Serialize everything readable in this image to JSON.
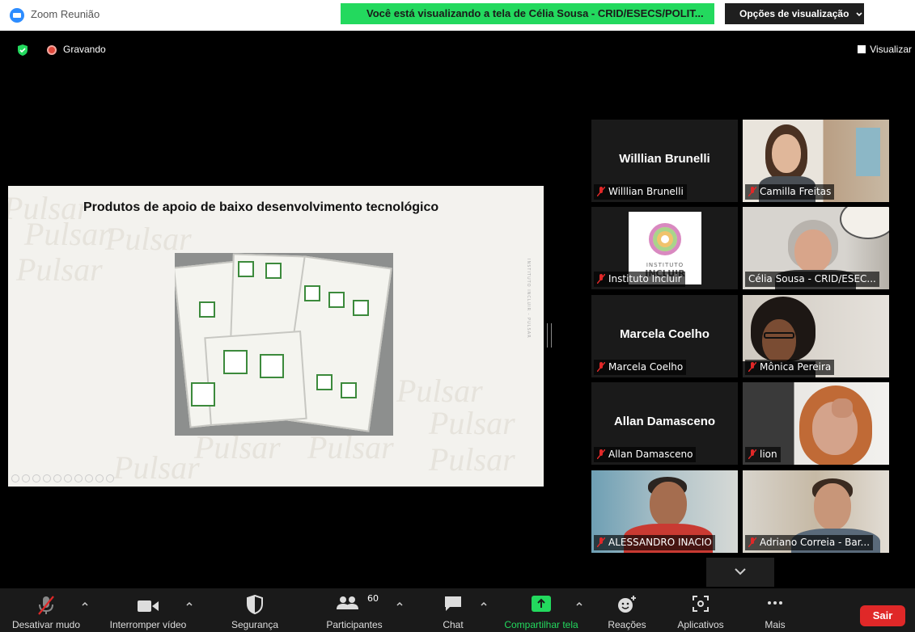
{
  "window": {
    "title": "Zoom Reunião",
    "share_banner": "Você está visualizando a tela de Célia Sousa - CRID/ESECS/POLIT...",
    "view_options": "Opções de visualização"
  },
  "status": {
    "recording_label": "Gravando",
    "view_button": "Visualizar"
  },
  "slide": {
    "title": "Produtos de apoio de baixo desenvolvimento tecnológico",
    "watermark": "Pulsar",
    "side_text": "INSTITUTO INCLUIR - PULSAR"
  },
  "participants": [
    {
      "name": "Willlian Brunelli",
      "display_name": "Willlian Brunelli",
      "video": false
    },
    {
      "name": "Camilla Freitas",
      "video": true
    },
    {
      "name": "Instituto Incluir",
      "video": true,
      "logo_top": "INSTITUTO",
      "logo_bottom": "INCLUIR"
    },
    {
      "name": "Célia Sousa - CRID/ESEC...",
      "video": true,
      "active": true
    },
    {
      "name": "Marcela Coelho",
      "display_name": "Marcela Coelho",
      "video": false
    },
    {
      "name": "Mônica Pereira",
      "video": true
    },
    {
      "name": "Allan Damasceno",
      "display_name": "Allan Damasceno",
      "video": false
    },
    {
      "name": "lion",
      "video": true
    },
    {
      "name": "ALESSANDRO INACIO",
      "video": true
    },
    {
      "name": "Adriano Correia - Bar...",
      "video": true
    }
  ],
  "toolbar": {
    "mute": "Desativar mudo",
    "video": "Interromper vídeo",
    "security": "Segurança",
    "participants": "Participantes",
    "participants_count": "60",
    "chat": "Chat",
    "share": "Compartilhar tela",
    "reactions": "Reações",
    "apps": "Aplicativos",
    "more": "Mais",
    "leave": "Sair"
  },
  "colors": {
    "share_green": "#23d95e",
    "leave_red": "#e02828",
    "active_speaker": "#d8f36a",
    "zoom_blue": "#2d8cff"
  }
}
